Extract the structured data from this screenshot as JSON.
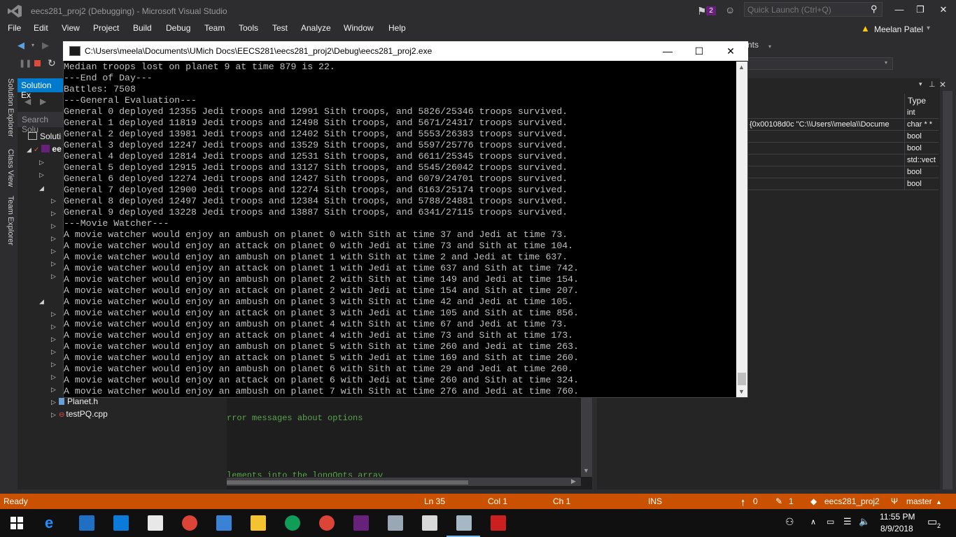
{
  "window": {
    "title": "eecs281_proj2 (Debugging) - Microsoft Visual Studio",
    "notif_count": "2",
    "quick_launch_placeholder": "Quick Launch (Ctrl+Q)",
    "user": "Meelan Patel"
  },
  "menu": [
    "File",
    "Edit",
    "View",
    "Project",
    "Build",
    "Debug",
    "Team",
    "Tools",
    "Test",
    "Analyze",
    "Window",
    "Help"
  ],
  "side_tabs": [
    "Solution Explorer",
    "Class View",
    "Team Explorer"
  ],
  "solution_explorer": {
    "header": "Solution Ex",
    "search_placeholder": "Search Solu",
    "tree": [
      "Soluti",
      "ee",
      "Planet.h",
      "testPQ.cpp"
    ]
  },
  "editor": {
    "lines": [
      "rror messages about options",
      "lements into the longOpts array"
    ]
  },
  "locals": {
    "col_type": "Type",
    "rows": [
      {
        "value": "",
        "type": "int"
      },
      {
        "value": "{0x00108d0c \"C:\\\\Users\\\\meela\\\\Docume",
        "type": "char * *"
      },
      {
        "value": "",
        "type": "bool"
      },
      {
        "value": "",
        "type": "bool"
      },
      {
        "value": "",
        "type": "std::vect"
      },
      {
        "value": "",
        "type": "bool"
      },
      {
        "value": "",
        "type": "bool"
      }
    ],
    "toolbar_fragment": "nts"
  },
  "console": {
    "title": "C:\\Users\\meela\\Documents\\UMich Docs\\EECS281\\eecs281_proj2\\Debug\\eecs281_proj2.exe",
    "lines": [
      "Median troops lost on planet 9 at time 879 is 22.",
      "---End of Day---",
      "Battles: 7508",
      "---General Evaluation---",
      "General 0 deployed 12355 Jedi troops and 12991 Sith troops, and 5826/25346 troops survived.",
      "General 1 deployed 11819 Jedi troops and 12498 Sith troops, and 5671/24317 troops survived.",
      "General 2 deployed 13981 Jedi troops and 12402 Sith troops, and 5553/26383 troops survived.",
      "General 3 deployed 12247 Jedi troops and 13529 Sith troops, and 5597/25776 troops survived.",
      "General 4 deployed 12814 Jedi troops and 12531 Sith troops, and 6611/25345 troops survived.",
      "General 5 deployed 12915 Jedi troops and 13127 Sith troops, and 5545/26042 troops survived.",
      "General 6 deployed 12274 Jedi troops and 12427 Sith troops, and 6079/24701 troops survived.",
      "General 7 deployed 12900 Jedi troops and 12274 Sith troops, and 6163/25174 troops survived.",
      "General 8 deployed 12497 Jedi troops and 12384 Sith troops, and 5788/24881 troops survived.",
      "General 9 deployed 13228 Jedi troops and 13887 Sith troops, and 6341/27115 troops survived.",
      "---Movie Watcher---",
      "A movie watcher would enjoy an ambush on planet 0 with Sith at time 37 and Jedi at time 73.",
      "A movie watcher would enjoy an attack on planet 0 with Jedi at time 73 and Sith at time 104.",
      "A movie watcher would enjoy an ambush on planet 1 with Sith at time 2 and Jedi at time 637.",
      "A movie watcher would enjoy an attack on planet 1 with Jedi at time 637 and Sith at time 742.",
      "A movie watcher would enjoy an ambush on planet 2 with Sith at time 149 and Jedi at time 154.",
      "A movie watcher would enjoy an attack on planet 2 with Jedi at time 154 and Sith at time 207.",
      "A movie watcher would enjoy an ambush on planet 3 with Sith at time 42 and Jedi at time 105.",
      "A movie watcher would enjoy an attack on planet 3 with Jedi at time 105 and Sith at time 856.",
      "A movie watcher would enjoy an ambush on planet 4 with Sith at time 67 and Jedi at time 73.",
      "A movie watcher would enjoy an attack on planet 4 with Jedi at time 73 and Sith at time 173.",
      "A movie watcher would enjoy an ambush on planet 5 with Sith at time 260 and Jedi at time 263.",
      "A movie watcher would enjoy an attack on planet 5 with Jedi at time 169 and Sith at time 260.",
      "A movie watcher would enjoy an ambush on planet 6 with Sith at time 29 and Jedi at time 260.",
      "A movie watcher would enjoy an attack on planet 6 with Jedi at time 260 and Sith at time 324.",
      "A movie watcher would enjoy an ambush on planet 7 with Sith at time 276 and Jedi at time 760."
    ]
  },
  "status": {
    "ready": "Ready",
    "ln": "Ln 35",
    "col": "Col 1",
    "ch": "Ch 1",
    "ins": "INS",
    "up_count": "0",
    "edit_count": "1",
    "project": "eecs281_proj2",
    "branch": "master"
  },
  "taskbar": {
    "time": "11:55 PM",
    "date": "8/9/2018",
    "notification_count": "2"
  },
  "colors": {
    "accent": "#007acc",
    "status_bar": "#ca5100",
    "vs_purple": "#68217a"
  }
}
